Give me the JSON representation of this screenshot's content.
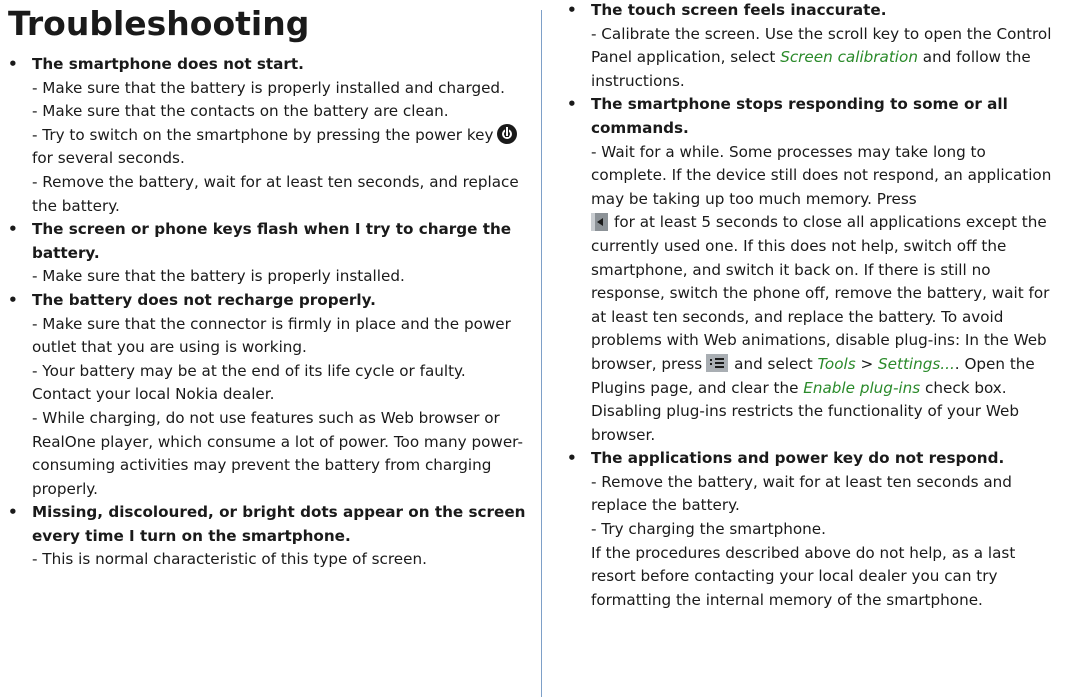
{
  "page": {
    "title": "Troubleshooting"
  },
  "bullet": "•",
  "left_items": [
    {
      "question": "The smartphone does not start.",
      "lines": [
        "- Make sure that the battery is properly installed and charged.",
        "- Make sure that the contacts on the battery are clean.",
        "- Try to switch on the smartphone by pressing the power key",
        "for several seconds.",
        "- Remove the battery, wait for at least ten seconds, and replace the battery."
      ]
    },
    {
      "question": "The screen or phone keys flash when I try to charge the battery.",
      "lines": [
        "- Make sure that the battery is properly installed."
      ]
    },
    {
      "question": "The battery does not recharge properly.",
      "lines": [
        "- Make sure that the connector is firmly in place and the power outlet that you are using is working.",
        "- Your battery may be at the end of its life cycle or faulty. Contact your local Nokia dealer.",
        "- While charging, do not use features such as Web browser or RealOne player, which consume a lot of power. Too many power-consuming activities may prevent the battery from charging properly."
      ]
    },
    {
      "question": "Missing, discoloured, or bright dots appear on the screen every time I turn on the smartphone.",
      "lines": [
        "- This is normal characteristic of this type of screen."
      ]
    }
  ],
  "right_items": [
    {
      "question": "The touch screen feels inaccurate.",
      "p1_a": "- Calibrate the screen. Use the scroll key to open the Control Panel application, select",
      "p1_link": "Screen calibration",
      "p1_b": "and follow the instructions."
    },
    {
      "question": "The smartphone stops responding to some or all commands.",
      "p1": "- Wait for a while. Some processes may take long to complete. If the device still does not respond, an application may be taking up too much memory. Press",
      "p2": "for at least 5 seconds to close all applications except the currently used one. If this does not help, switch off the smartphone, and switch it back on. If there is still no response, switch the phone off, remove the battery, wait for at least ten seconds, and replace the battery. To avoid problems with Web animations, disable plug-ins: In the Web browser, press",
      "p3": "and select",
      "link_tools": "Tools",
      "sep": ">",
      "link_settings": "Settings...",
      "p4": ". Open the Plugins page, and clear the",
      "link_plugins": "Enable plug-ins",
      "p5": "check box. Disabling plug-ins restricts the functionality of your Web browser."
    },
    {
      "question": "The applications and power key do not respond.",
      "lines": [
        "- Remove the battery, wait for at least ten seconds and replace the battery.",
        "- Try charging the smartphone.",
        "If the procedures described above do not help, as a last resort before contacting your local dealer you can try formatting the internal memory of the smartphone."
      ]
    }
  ],
  "icons": {
    "power_key": "power-icon",
    "back_key": "back-icon",
    "menu_key": "menu-icon"
  },
  "colors": {
    "link_green": "#2a8a2a",
    "divider_blue": "#7ea0c8"
  }
}
